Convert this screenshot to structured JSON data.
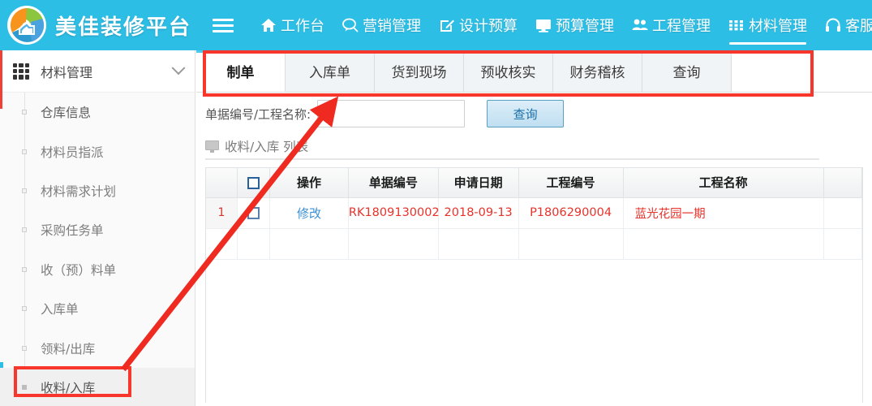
{
  "header": {
    "logo_icon": "circular-aperture-house-logo",
    "brand_title": "美佳装修平台",
    "menu_icon": "hamburger-icon",
    "nav": [
      {
        "label": "工作台",
        "icon": "home-icon",
        "active": false
      },
      {
        "label": "营销管理",
        "icon": "chat-bubble-icon",
        "active": false
      },
      {
        "label": "设计预算",
        "icon": "edit-square-icon",
        "active": false
      },
      {
        "label": "预算管理",
        "icon": "monitor-icon",
        "active": false
      },
      {
        "label": "工程管理",
        "icon": "users-icon",
        "active": false
      },
      {
        "label": "材料管理",
        "icon": "grid-apps-icon",
        "active": true
      },
      {
        "label": "客服管理",
        "icon": "headset-icon",
        "active": false
      }
    ],
    "accent_color": "#2dbee5"
  },
  "sidebar": {
    "title": "材料管理",
    "title_icon": "grid-apps-icon",
    "collapse_icon": "chevron-down-icon",
    "items": [
      {
        "label": "仓库信息",
        "active": false
      },
      {
        "label": "材料员指派",
        "active": false
      },
      {
        "label": "材料需求计划",
        "active": false
      },
      {
        "label": "采购任务单",
        "active": false
      },
      {
        "label": "收（预）料单",
        "active": false
      },
      {
        "label": "入库单",
        "active": false
      },
      {
        "label": "领料/出库",
        "active": false
      },
      {
        "label": "收料/入库",
        "active": true
      }
    ]
  },
  "tabs": [
    {
      "label": "制单",
      "active": true
    },
    {
      "label": "入库单",
      "active": false
    },
    {
      "label": "货到现场",
      "active": false
    },
    {
      "label": "预收核实",
      "active": false
    },
    {
      "label": "财务稽核",
      "active": false
    },
    {
      "label": "查询",
      "active": false
    }
  ],
  "search": {
    "label": "单据编号/工程名称:",
    "value": "",
    "placeholder": "",
    "button_label": "查询"
  },
  "list_title": {
    "icon": "monitor-icon",
    "text": "收料/入库 列表"
  },
  "table": {
    "columns": [
      {
        "key": "idx",
        "label": ""
      },
      {
        "key": "check",
        "label": "",
        "icon": "checkbox-icon"
      },
      {
        "key": "op",
        "label": "操作"
      },
      {
        "key": "doc_no",
        "label": "单据编号"
      },
      {
        "key": "apply_date",
        "label": "申请日期"
      },
      {
        "key": "proj_no",
        "label": "工程编号"
      },
      {
        "key": "proj_name",
        "label": "工程名称"
      },
      {
        "key": "extra",
        "label": ""
      }
    ],
    "rows": [
      {
        "idx": "1",
        "op": "修改",
        "doc_no": "RK1809130002",
        "apply_date": "2018-09-13",
        "proj_no": "P1806290004",
        "proj_name": "蓝光花园一期"
      }
    ]
  },
  "annotations": {
    "color": "#f9362b",
    "tab_highlight_target": "制单",
    "sidebar_highlight_target": "收料/入库",
    "arrow": "points from 收料/入库 sidebar item up to 制单 tab area"
  }
}
